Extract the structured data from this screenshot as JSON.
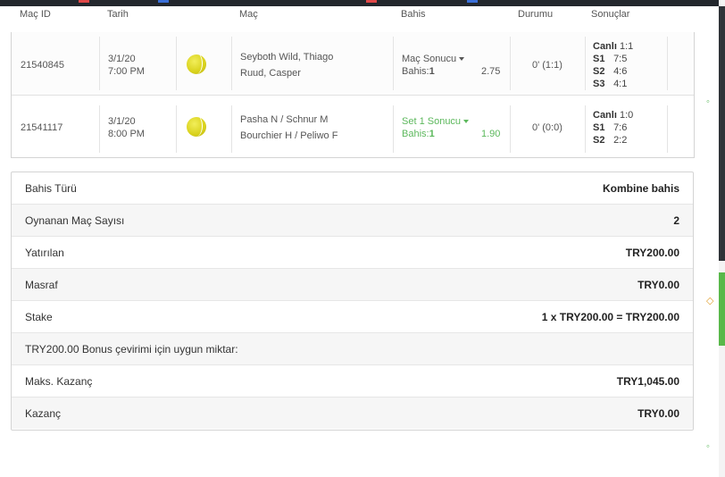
{
  "columns": {
    "match_id": "Maç ID",
    "date": "Tarih",
    "match": "Maç",
    "bet": "Bahis",
    "status": "Durumu",
    "results": "Sonuçlar"
  },
  "matches": [
    {
      "id": "21540845",
      "date": "3/1/20",
      "time": "7:00 PM",
      "sport_icon": "tennis-ball-icon",
      "team1": "Seyboth Wild, Thiago",
      "team2": "Ruud, Casper",
      "market": "Maç Sonucu",
      "selection_label": "Bahis:",
      "selection_value": "1",
      "odds": "2.75",
      "status": "0' (1:1)",
      "results": [
        {
          "label": "Canlı",
          "value": "1:1"
        },
        {
          "label": "S1",
          "value": "7:5"
        },
        {
          "label": "S2",
          "value": "4:6"
        },
        {
          "label": "S3",
          "value": "4:1"
        }
      ]
    },
    {
      "id": "21541117",
      "date": "3/1/20",
      "time": "8:00 PM",
      "sport_icon": "tennis-ball-icon",
      "team1": "Pasha N / Schnur M",
      "team2": "Bourchier H / Peliwo F",
      "market": "Set 1 Sonucu",
      "selection_label": "Bahis:",
      "selection_value": "1",
      "odds": "1.90",
      "status": "0' (0:0)",
      "results": [
        {
          "label": "Canlı",
          "value": "1:0"
        },
        {
          "label": "S1",
          "value": "7:6"
        },
        {
          "label": "S2",
          "value": "2:2"
        }
      ]
    }
  ],
  "summary": [
    {
      "label": "Bahis Türü",
      "value": "Kombine bahis"
    },
    {
      "label": "Oynanan Maç Sayısı",
      "value": "2"
    },
    {
      "label": "Yatırılan",
      "value": "TRY200.00"
    },
    {
      "label": "Masraf",
      "value": "TRY0.00"
    },
    {
      "label": "Stake",
      "value": "1 x TRY200.00 = TRY200.00"
    },
    {
      "label": "TRY200.00 Bonus çevirimi için uygun miktar:",
      "value": ""
    },
    {
      "label": "Maks. Kazanç",
      "value": "TRY1,045.00"
    },
    {
      "label": "Kazanç",
      "value": "TRY0.00"
    }
  ],
  "colors": {
    "accent_green": "#5cb85c",
    "top_bar": "#23272d",
    "ball": "#d9d21c"
  }
}
